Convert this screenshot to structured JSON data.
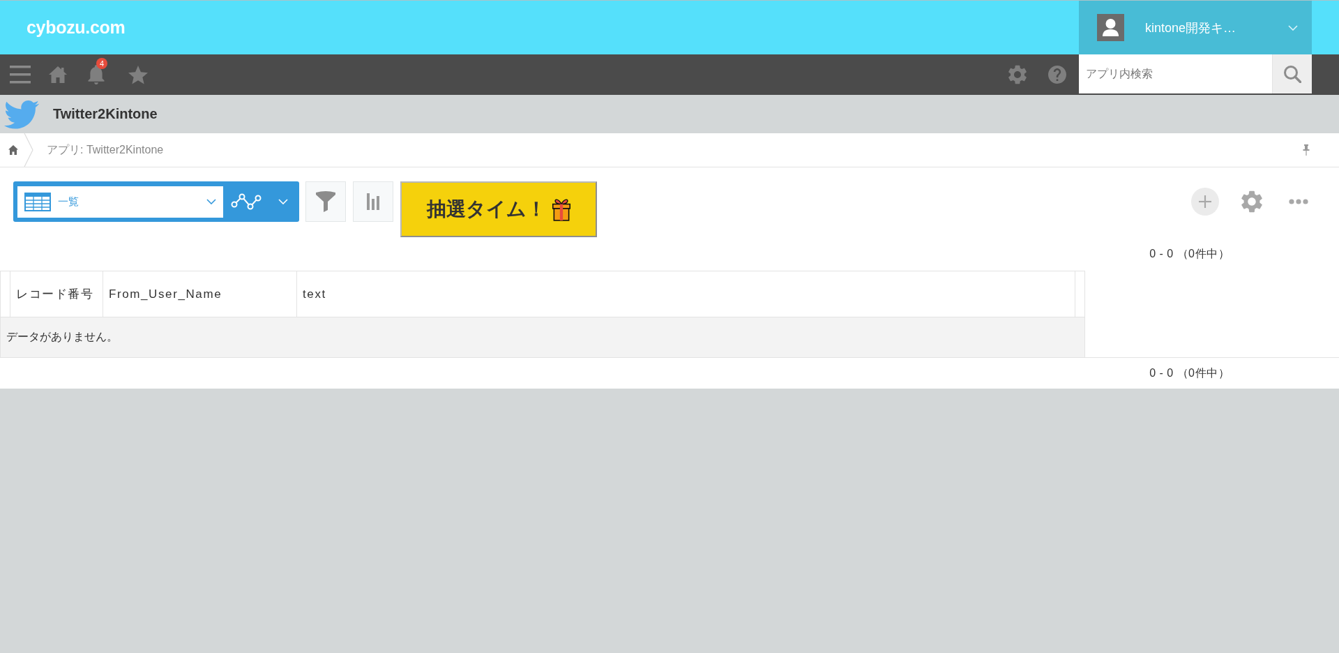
{
  "header": {
    "logo": "cybozu.com",
    "user": {
      "name": "kintone開発キ…"
    }
  },
  "nav": {
    "notification_count": "4",
    "search": {
      "placeholder": "アプリ内検索"
    }
  },
  "app": {
    "title": "Twitter2Kintone"
  },
  "breadcrumb": {
    "items": [
      "アプリ: Twitter2Kintone"
    ]
  },
  "toolbar": {
    "view": {
      "label": "一覧"
    },
    "lottery_button": {
      "label": "抽選タイム！"
    }
  },
  "pagination_top": "0 - 0 （0件中）",
  "table": {
    "columns": [
      "レコード番号",
      "From_User_Name",
      "text"
    ],
    "empty_message": "データがありません。"
  },
  "pagination_bottom": "0 - 0 （0件中）"
}
